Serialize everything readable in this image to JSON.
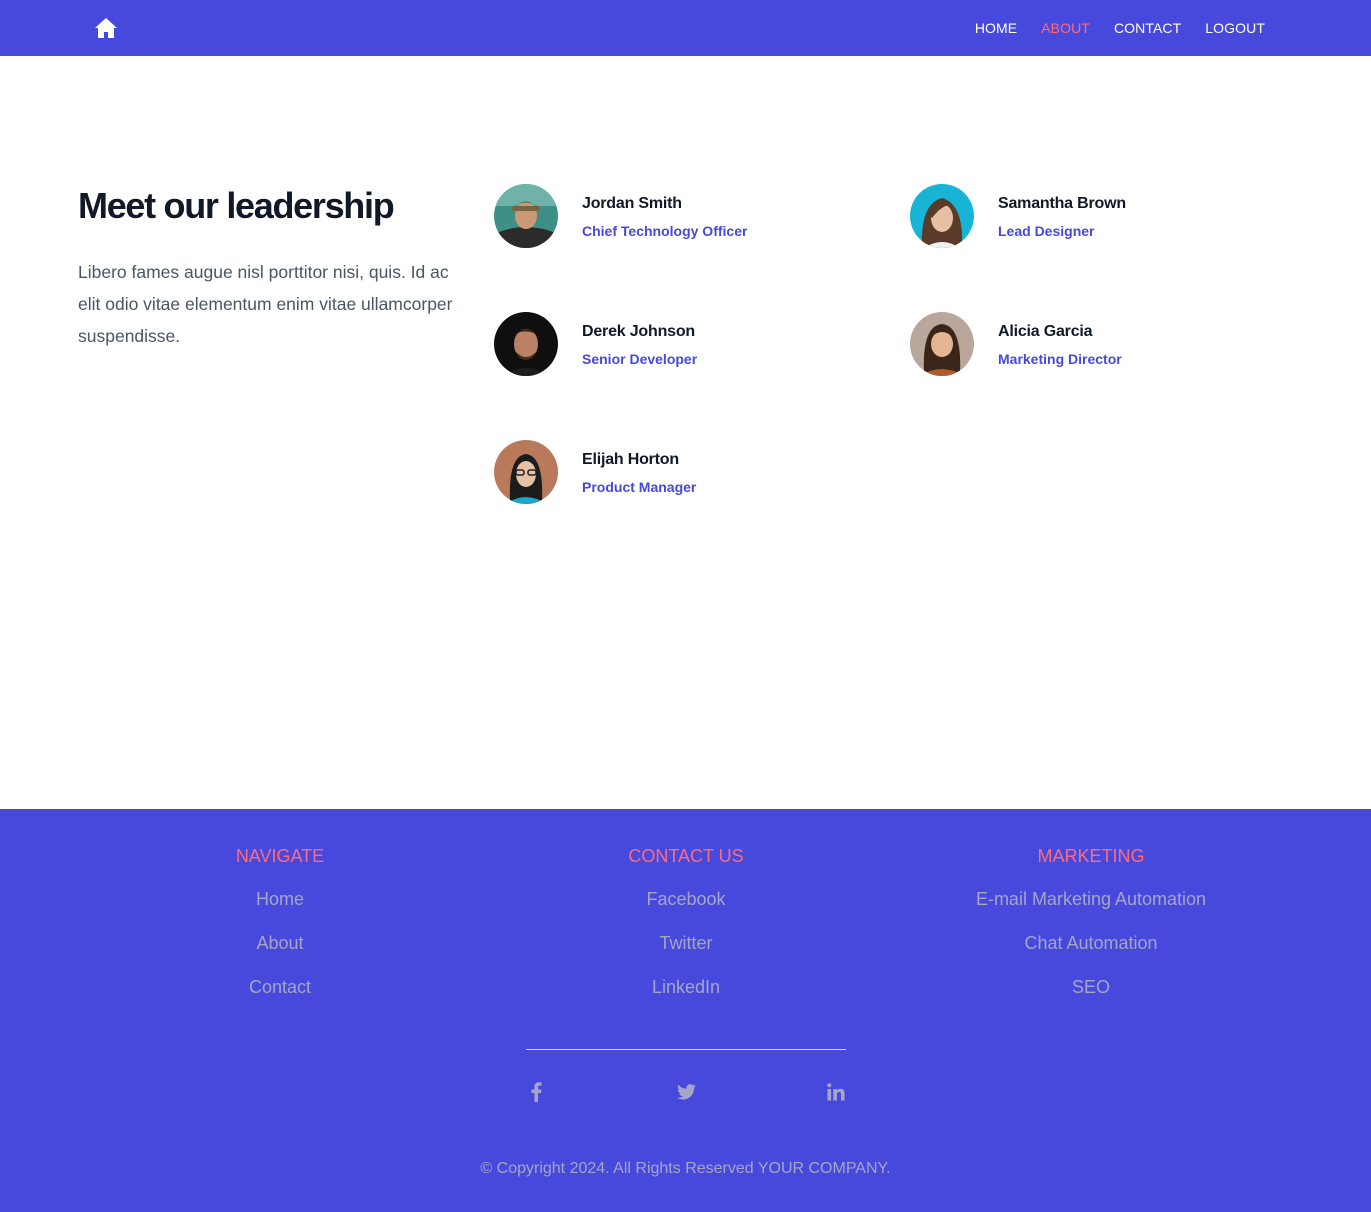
{
  "header": {
    "logo_icon": "home-icon",
    "nav": [
      {
        "label": "HOME",
        "active": false
      },
      {
        "label": "ABOUT",
        "active": true
      },
      {
        "label": "CONTACT",
        "active": false
      },
      {
        "label": "LOGOUT",
        "active": false
      }
    ]
  },
  "leadership": {
    "title": "Meet our leadership",
    "description": "Libero fames augue nisl porttitor nisi, quis. Id ac elit odio vitae elementum enim vitae ullamcorper suspendisse.",
    "people": [
      {
        "name": "Jordan Smith",
        "role": "Chief Technology Officer"
      },
      {
        "name": "Samantha Brown",
        "role": "Lead Designer"
      },
      {
        "name": "Derek Johnson",
        "role": "Senior Developer"
      },
      {
        "name": "Alicia Garcia",
        "role": "Marketing Director"
      },
      {
        "name": "Elijah Horton",
        "role": "Product Manager"
      }
    ]
  },
  "footer": {
    "columns": [
      {
        "heading": "NAVIGATE",
        "links": [
          "Home",
          "About",
          "Contact"
        ]
      },
      {
        "heading": "CONTACT US",
        "links": [
          "Facebook",
          "Twitter",
          "LinkedIn"
        ]
      },
      {
        "heading": "MARKETING",
        "links": [
          "E-mail Marketing Automation",
          "Chat Automation",
          "SEO"
        ]
      }
    ],
    "social_icons": [
      "facebook-icon",
      "twitter-icon",
      "linkedin-icon"
    ],
    "copyright": "© Copyright 2024. All Rights Reserved YOUR COMPANY."
  },
  "colors": {
    "brand": "#4649dc",
    "accent": "#ff6b7d",
    "footer_text": "#a5a5ca",
    "heading": "#111827",
    "body_text": "#4b5563"
  }
}
